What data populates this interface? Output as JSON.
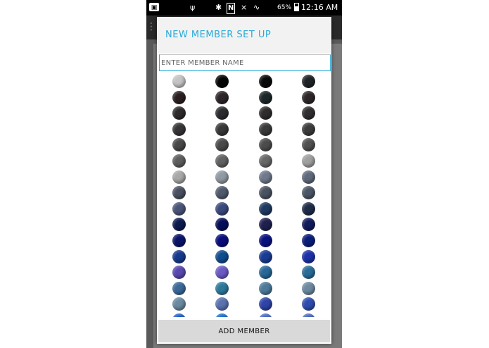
{
  "status_bar": {
    "notification_icon": "picture-icon",
    "usb_icon": "usb-icon",
    "bluetooth_icon": "bluetooth-icon",
    "nfc_icon": "N",
    "mute_icon": "mute-icon",
    "wifi_icon": "wifi-icon",
    "battery_percent": "65%",
    "battery_level": 0.65,
    "time": "12:16 AM"
  },
  "dialog": {
    "title": "NEW MEMBER SET UP",
    "name_input": {
      "placeholder": "ENTER MEMBER NAME",
      "value": ""
    },
    "add_button_label": "ADD MEMBER"
  },
  "swatches": {
    "columns": 4,
    "rows": [
      [
        "#c4c4c4",
        "#050505",
        "#0a0a0a",
        "#202428"
      ],
      [
        "#2a1e20",
        "#2c2428",
        "#1c2628",
        "#2c2628"
      ],
      [
        "#2e2a2c",
        "#2c2c30",
        "#302c2e",
        "#302e30"
      ],
      [
        "#363436",
        "#38383a",
        "#3a3a3a",
        "#3c3c3c"
      ],
      [
        "#484848",
        "#4a4a4a",
        "#4c4c4c",
        "#505050"
      ],
      [
        "#5e5e5e",
        "#626262",
        "#686868",
        "#a0a0a0"
      ],
      [
        "#a8a8a8",
        "#909aa2",
        "#707a8c",
        "#606a7c"
      ],
      [
        "#4a5060",
        "#505a6c",
        "#4a5262",
        "#4a5666"
      ],
      [
        "#4a5478",
        "#3a4a7c",
        "#1e3a60",
        "#1e2c48"
      ],
      [
        "#0c1a4e",
        "#060e5a",
        "#202050",
        "#101c5c"
      ],
      [
        "#0a146a",
        "#080c7c",
        "#0a1280",
        "#0a1e78"
      ],
      [
        "#163a8c",
        "#104c8e",
        "#1a3c94",
        "#1c30a8"
      ],
      [
        "#5a48b0",
        "#6a5ac4",
        "#286898",
        "#2a6c98"
      ],
      [
        "#3a6898",
        "#2c789a",
        "#4c7a9a",
        "#6e8aa0"
      ],
      [
        "#6a8aa0",
        "#5a72b0",
        "#2e44a8",
        "#2e4cb0"
      ],
      [
        "#1e60c8",
        "#1a70cc",
        "#4a6ac0",
        "#4a68c0"
      ]
    ]
  }
}
